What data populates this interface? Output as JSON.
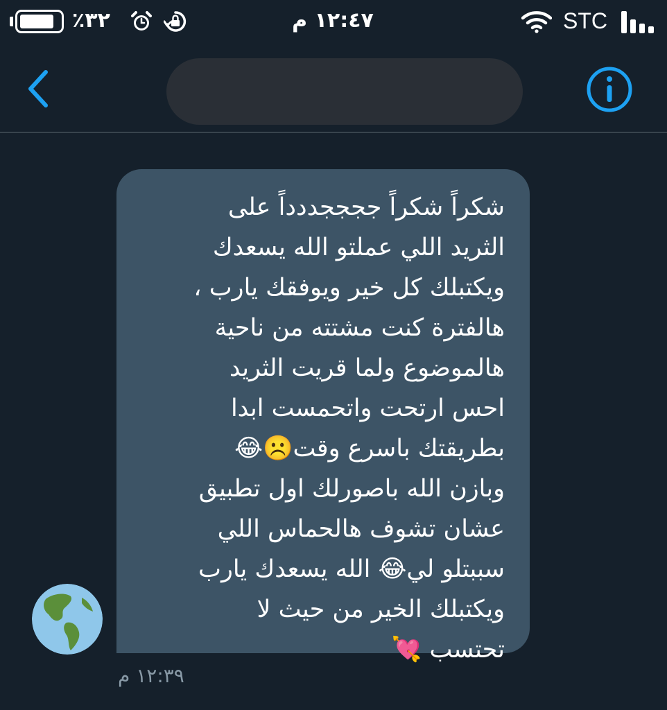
{
  "status_bar": {
    "battery_percent": "٪٣٢",
    "battery_level": 0.32,
    "time": "١٢:٤٧ م",
    "carrier": "STC",
    "icons": [
      "battery-icon",
      "alarm-icon",
      "rotation-lock-icon",
      "wifi-icon",
      "signal-icon"
    ]
  },
  "header": {
    "back_icon": "chevron-left-icon",
    "info_icon": "info-icon"
  },
  "message": {
    "text": "شكراً شكراً ججججددداً على\nالثريد اللي عملتو الله يسعدك\nويكتبلك كل خير ويوفقك يارب ،\nهالفترة كنت مشتته من ناحية\nهالموضوع ولما قريت الثريد\nاحس ارتحت واتحمست ابدا\nبطريقتك باسرع وقت☹️😂\nوبازن الله باصورلك اول تطبيق\nعشان تشوف هالحماس اللي\nسببتلو لي😂 الله يسعدك يارب\nويكتبلك الخير من حيث لا\nتحتسب 💘",
    "time": "١٢:٣٩ م",
    "avatar_icon": "globe-americas-icon"
  },
  "colors": {
    "background": "#15202b",
    "bubble": "#3d5466",
    "accent": "#1da1f2",
    "muted": "#8899a6",
    "divider": "#38444d"
  }
}
